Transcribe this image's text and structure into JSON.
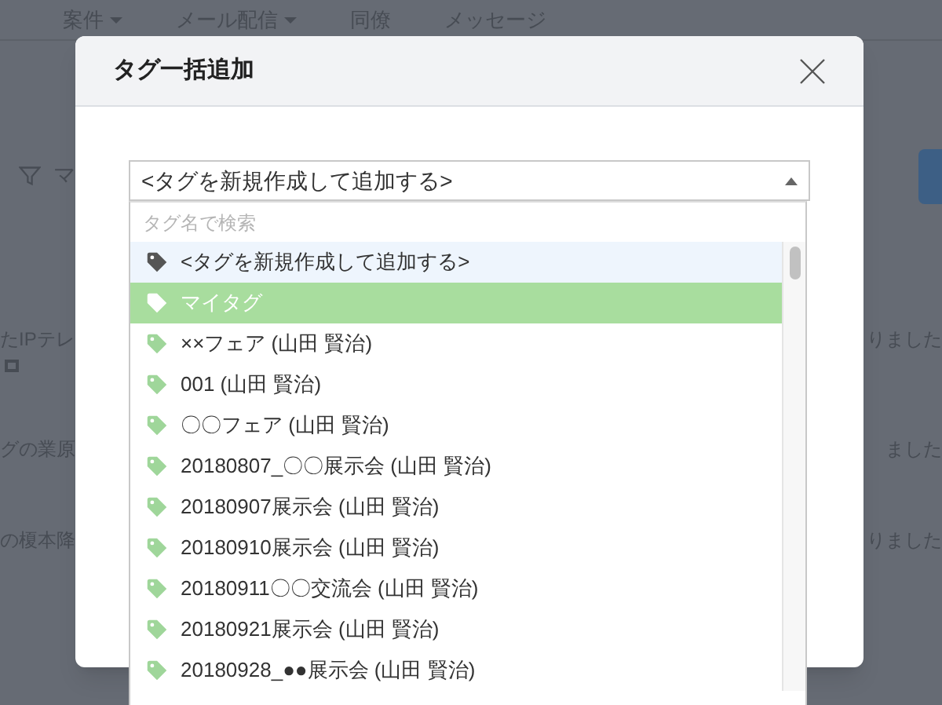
{
  "nav": [
    {
      "label": "案件",
      "caret": true
    },
    {
      "label": "メール配信",
      "caret": true
    },
    {
      "label": "同僚",
      "caret": false
    },
    {
      "label": "メッセージ",
      "caret": false
    }
  ],
  "background": {
    "filter_label": "マ",
    "rows": [
      {
        "left": "たIPテレ",
        "right": "りました",
        "window_icon": true
      },
      {
        "left": "グの業原",
        "right": "ました",
        "window_icon": false
      },
      {
        "left": "の榎本降",
        "right": "りました",
        "window_icon": false
      }
    ]
  },
  "modal": {
    "title": "タグ一括追加",
    "select": {
      "value": "<タグを新規作成して追加する>",
      "expanded": true
    },
    "search": {
      "placeholder": "タグ名で検索"
    },
    "options": [
      {
        "label": "<タグを新規作成して追加する>",
        "highlighted": true,
        "selected": false
      },
      {
        "label": "マイタグ",
        "highlighted": false,
        "selected": true
      },
      {
        "label": "××フェア (山田 賢治)",
        "highlighted": false,
        "selected": false
      },
      {
        "label": "001 (山田 賢治)",
        "highlighted": false,
        "selected": false
      },
      {
        "label": "〇〇フェア (山田 賢治)",
        "highlighted": false,
        "selected": false
      },
      {
        "label": "20180807_〇〇展示会 (山田 賢治)",
        "highlighted": false,
        "selected": false
      },
      {
        "label": "20180907展示会 (山田 賢治)",
        "highlighted": false,
        "selected": false
      },
      {
        "label": "20180910展示会 (山田 賢治)",
        "highlighted": false,
        "selected": false
      },
      {
        "label": "20180911〇〇交流会 (山田 賢治)",
        "highlighted": false,
        "selected": false
      },
      {
        "label": "20180921展示会 (山田 賢治)",
        "highlighted": false,
        "selected": false
      },
      {
        "label": "20180928_●●展示会 (山田 賢治)",
        "highlighted": false,
        "selected": false
      }
    ]
  }
}
